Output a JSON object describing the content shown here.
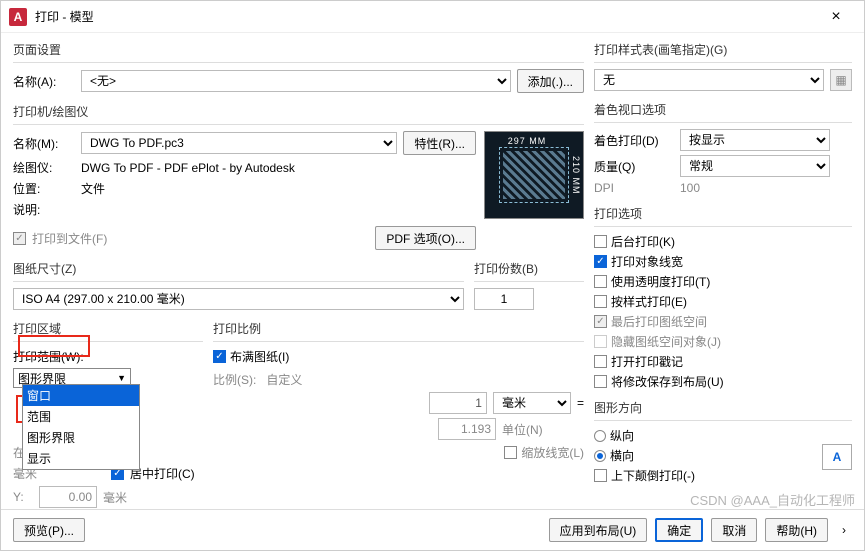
{
  "titlebar": {
    "app_initial": "A",
    "title": "打印 - 模型",
    "close": "×"
  },
  "page_setup": {
    "title": "页面设置",
    "name_lbl": "名称(A):",
    "name_val": "<无>",
    "add_btn": "添加(.)..."
  },
  "style_table": {
    "title": "打印样式表(画笔指定)(G)",
    "value": "无"
  },
  "printer": {
    "title": "打印机/绘图仪",
    "name_lbl": "名称(M):",
    "name_val": "DWG To PDF.pc3",
    "props_btn": "特性(R)...",
    "plotter_lbl": "绘图仪:",
    "plotter_val": "DWG To PDF - PDF ePlot - by Autodesk",
    "where_lbl": "位置:",
    "where_val": "文件",
    "desc_lbl": "说明:",
    "to_file": "打印到文件(F)",
    "pdf_opts": "PDF 选项(O)...",
    "preview_top": "297 MM",
    "preview_right": "210 MM"
  },
  "viewport": {
    "title": "着色视口选项",
    "shade_lbl": "着色打印(D)",
    "shade_val": "按显示",
    "quality_lbl": "质量(Q)",
    "quality_val": "常规",
    "dpi_lbl": "DPI",
    "dpi_val": "100"
  },
  "paper": {
    "title": "图纸尺寸(Z)",
    "value": "ISO A4 (297.00 x 210.00 毫米)"
  },
  "copies": {
    "title": "打印份数(B)",
    "value": "1"
  },
  "plot_opts": {
    "title": "打印选项",
    "bg": "后台打印(K)",
    "lw": "打印对象线宽",
    "trans": "使用透明度打印(T)",
    "styles": "按样式打印(E)",
    "last": "最后打印图纸空间",
    "hide": "隐藏图纸空间对象(J)",
    "stamp": "打开打印戳记",
    "save": "将修改保存到布局(U)"
  },
  "area": {
    "title": "打印区域",
    "what_lbl": "打印范围(W):",
    "header_val": "图形界限",
    "opts": [
      "窗口",
      "范围",
      "图形界限",
      "显示"
    ]
  },
  "offset": {
    "title": "在可打印区域)",
    "unit_x": "毫米",
    "center": "居中打印(C)",
    "y_lbl": "Y:",
    "y_val": "0.00",
    "unit_y": "毫米"
  },
  "scale": {
    "title": "打印比例",
    "fit": "布满图纸(I)",
    "scale_lbl": "比例(S):",
    "scale_val": "自定义",
    "mm_val": "1",
    "mm_unit": "毫米",
    "eq": "=",
    "unit_val": "1.193",
    "unit_unit": "单位(N)",
    "scale_lw": "缩放线宽(L)"
  },
  "orient": {
    "title": "图形方向",
    "portrait": "纵向",
    "landscape": "横向",
    "upside": "上下颠倒打印(-)",
    "letter": "A"
  },
  "footer": {
    "preview": "预览(P)...",
    "apply": "应用到布局(U)",
    "ok": "确定",
    "cancel": "取消",
    "help": "帮助(H)"
  },
  "watermark": "CSDN @AAA_自动化工程师"
}
